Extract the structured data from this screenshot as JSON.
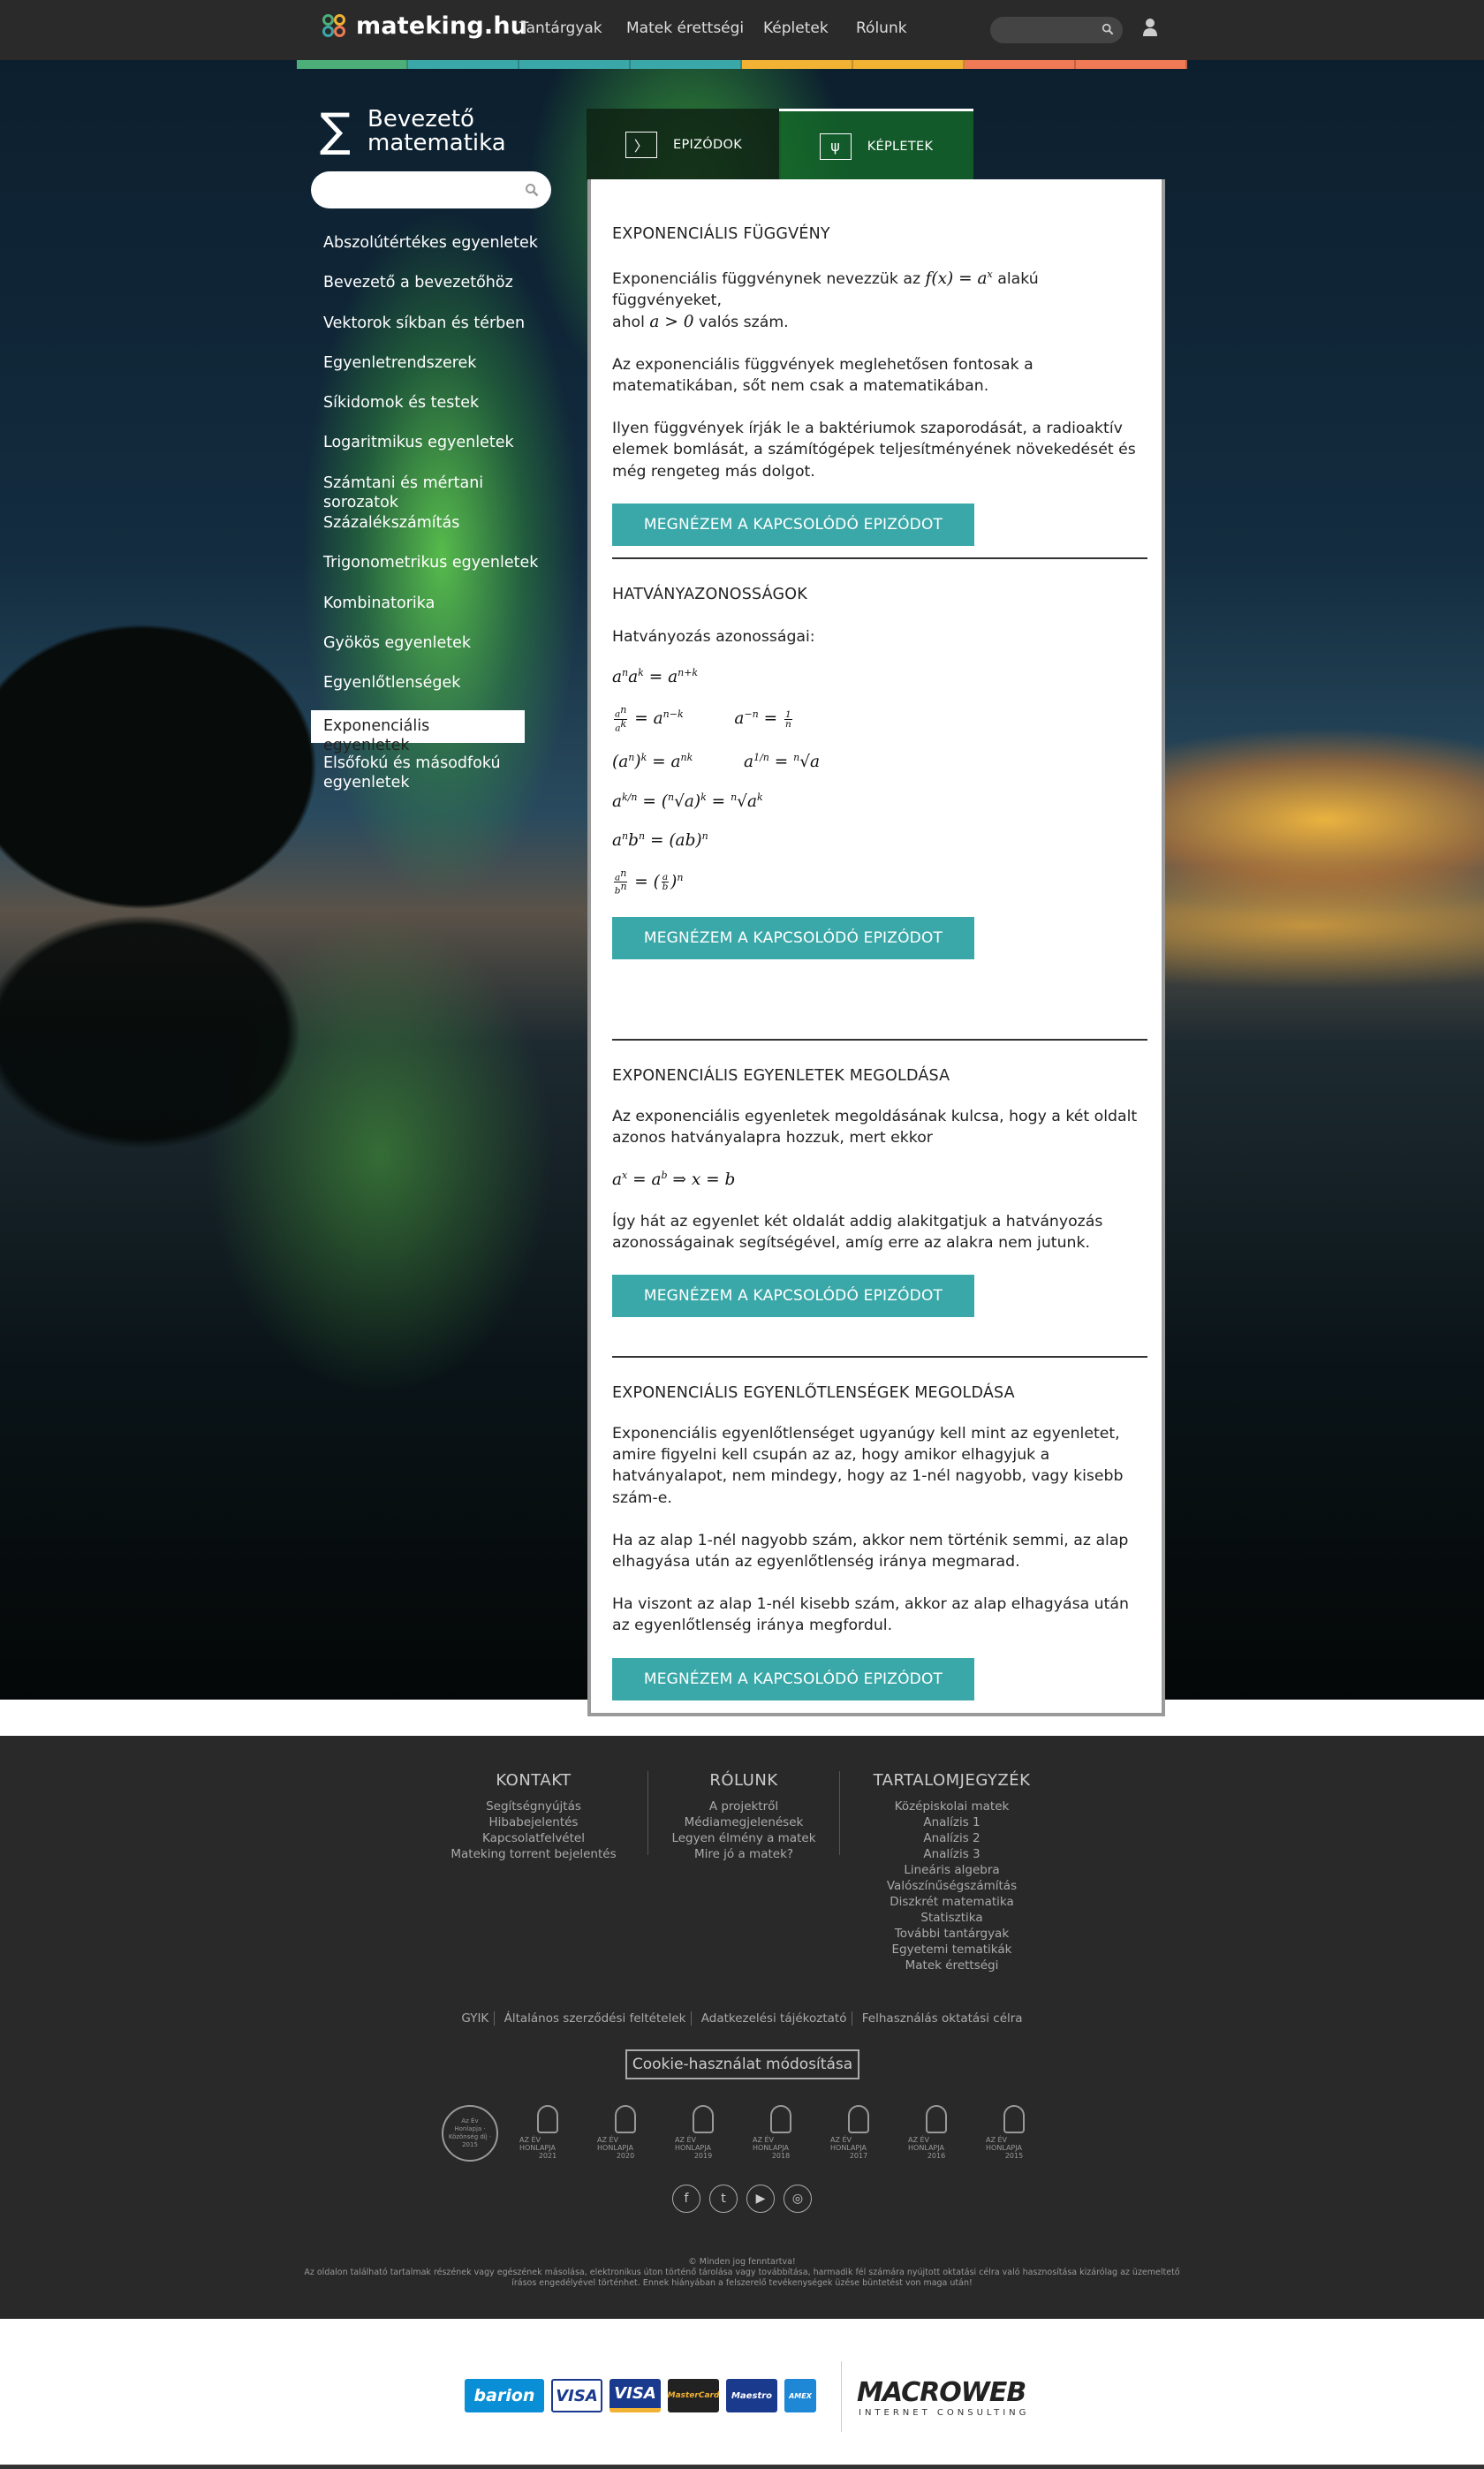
{
  "header": {
    "logo_text": "mateking.hu",
    "nav": [
      "Tantárgyak",
      "Matek érettségi",
      "Képletek",
      "Rólunk"
    ],
    "icons": [
      "search-icon",
      "user-icon"
    ]
  },
  "colors": {
    "topbar": "#2a2a2a",
    "accent_teal": "#3aa8a8",
    "colorbar": [
      "#4caf7a",
      "#3aa8a8",
      "#3aa8a8",
      "#3aa8a8",
      "#f2b233",
      "#f2b233",
      "#f07a55",
      "#f07a55"
    ]
  },
  "sidebar": {
    "course_title_line1": "Bevezető",
    "course_title_line2": "matematika",
    "items": [
      "Abszolútértékes egyenletek",
      "Bevezető a bevezetőhöz",
      "Vektorok síkban és térben",
      "Egyenletrendszerek",
      "Síkidomok és testek",
      "Logaritmikus egyenletek",
      "Számtani és mértani sorozatok",
      "Százalékszámítás",
      "Trigonometrikus egyenletek",
      "Kombinatorika",
      "Gyökös egyenletek",
      "Egyenlőtlenségek",
      "Exponenciális egyenletek",
      "Elsőfokú és másodfokú egyenletek"
    ],
    "active_item": "Exponenciális egyenletek"
  },
  "tabs": {
    "episodes": "EPIZÓDOK",
    "formulas": "KÉPLETEK",
    "active": "KÉPLETEK"
  },
  "content": {
    "button_label": "MEGNÉZEM A KAPCSOLÓDÓ EPIZÓDOT",
    "s1": {
      "title": "EXPONENCIÁLIS FÜGGVÉNY",
      "p1a": "Exponenciális függvénynek nevezzük az",
      "p1b": "alakú függvényeket,",
      "p1c": "ahol",
      "p1d": "valós szám.",
      "p2": "Az exponenciális függvények meglehetősen fontosak a matematikában, sőt nem csak a matematikában.",
      "p3": "Ilyen függvények írják le a baktériumok szaporodását, a radioaktív elemek bomlását, a számítógépek teljesítményének növekedését és még rengeteg más dolgot."
    },
    "s2": {
      "title": "HATVÁNYAZONOSSÁGOK",
      "intro": "Hatványozás azonosságai:"
    },
    "s3": {
      "title": "EXPONENCIÁLIS EGYENLETEK MEGOLDÁSA",
      "p1": "Az exponenciális egyenletek megoldásának kulcsa, hogy a két oldalt azonos hatványalapra hozzuk, mert ekkor",
      "p2": "Így hát az egyenlet két oldalát addig alakitgatjuk a hatványozás azonosságainak segítségével, amíg erre az alakra nem jutunk."
    },
    "s4": {
      "title": "EXPONENCIÁLIS EGYENLŐTLENSÉGEK MEGOLDÁSA",
      "p1": "Exponenciális egyenlőtlenséget ugyanúgy kell mint az egyenletet, amire figyelni kell csupán az az, hogy amikor elhagyjuk a hatványalapot, nem mindegy, hogy az 1-nél nagyobb, vagy kisebb szám-e.",
      "p2": "Ha az alap 1-nél nagyobb szám, akkor nem történik semmi, az alap elhagyása után az egyenlőtlenség iránya megmarad.",
      "p3": "Ha viszont az alap 1-nél kisebb szám, akkor az alap elhagyása után az egyenlőtlenség iránya megfordul."
    }
  },
  "footer": {
    "kontakt": {
      "title": "KONTAKT",
      "links": [
        "Segítségnyújtás",
        "Hibabejelentés",
        "Kapcsolatfelvétel",
        "Mateking torrent bejelentés"
      ]
    },
    "rolunk": {
      "title": "RÓLUNK",
      "links": [
        "A projektről",
        "Médiamegjelenések",
        "Legyen élmény a matek",
        "Mire jó a matek?"
      ]
    },
    "toc": {
      "title": "TARTALOMJEGYZÉK",
      "links": [
        "Középiskolai matek",
        "Analízis 1",
        "Analízis 2",
        "Analízis 3",
        "Lineáris algebra",
        "Valószínűségszámítás",
        "Diszkrét matematika",
        "Statisztika",
        "További tantárgyak",
        "Egyetemi tematikák",
        "Matek érettségi"
      ]
    },
    "legal_links": [
      "GYIK",
      "Általános szerződési feltételek",
      "Adatkezelési tájékoztató",
      "Felhasználás oktatási célra"
    ],
    "cookie_button": "Cookie-használat módosítása",
    "award_label": "AZ ÉV HONLAPJA",
    "award_years": [
      "2021",
      "2020",
      "2019",
      "2018",
      "2017",
      "2016",
      "2015"
    ],
    "award_round": "Az Év Honlapja · Közönség díj · 2015",
    "social_icons": [
      "facebook-icon",
      "twitter-icon",
      "youtube-icon",
      "instagram-icon"
    ],
    "copyright": "© Minden jog fenntartva!",
    "disclaimer": "Az oldalon található tartalmak részének vagy egészének másolása, elektronikus úton történő tárolása vagy továbbítása, harmadik fél számára nyújtott oktatási célra való hasznosítása kizárólag az üzemeltető írásos engedélyével történhet. Ennek hiányában a felszerelő tevékenységek üzése büntetést von maga után!"
  },
  "payment": {
    "logos": [
      "barion",
      "VISA",
      "VISA",
      "MasterCard",
      "Maestro",
      "AMEX"
    ],
    "partner": "MACROWEB",
    "partner_sub": "INTERNET CONSULTING"
  }
}
